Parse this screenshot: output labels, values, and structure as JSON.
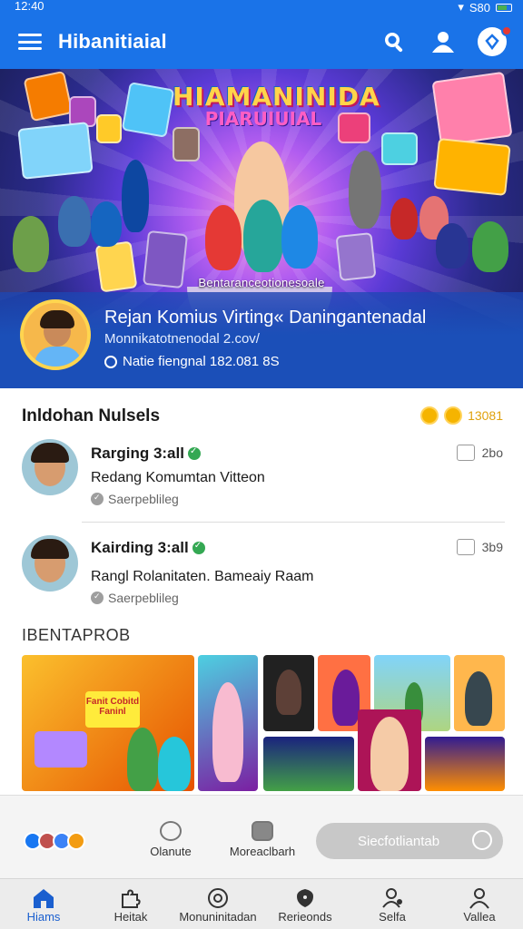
{
  "status_bar": {
    "time": "12:40",
    "signal": "S80"
  },
  "app_bar": {
    "title": "Hibanitiaial",
    "icons": [
      "menu-icon",
      "search-icon",
      "profile-icon",
      "notification-icon"
    ]
  },
  "hero": {
    "banner_line1": "HIAMANINIDA",
    "banner_line2": "PIARUIUIAL",
    "caption": "Bentaranceotionesoale",
    "profile_name": "Rejan Komius Virting« Daningantenadal",
    "profile_handle": "Monnikatotnenodal 2.cov/",
    "profile_meta": "Natie fiengnal  182.081 8S"
  },
  "feed": {
    "section_title": "Inldohan Nulsels",
    "section_count": "13081",
    "posts": [
      {
        "author": "Rarging 3:all",
        "text": "Redang Komumtan Vitteon",
        "sub": "Saerpeblileg",
        "time": "2bo"
      },
      {
        "author": "Kairding 3:all",
        "text": "Rangl Rolanitaten. Bameaiy Raam",
        "sub": "Saerpeblileg",
        "time": "3b9"
      }
    ]
  },
  "gallery": {
    "title": "IBENTAPROB",
    "tile_text": "Fanit Cobitd Faninl"
  },
  "share_row": {
    "action1": "Olanute",
    "action2": "Moreaclbarh",
    "cta": "Siecfotliantab"
  },
  "bottom_nav": {
    "items": [
      {
        "label": "Hiams",
        "icon": "home-icon"
      },
      {
        "label": "Heitak",
        "icon": "puzzle-icon"
      },
      {
        "label": "Monuninitadan",
        "icon": "target-icon"
      },
      {
        "label": "Rerieonds",
        "icon": "shield-icon"
      },
      {
        "label": "Selfa",
        "icon": "user-settings-icon"
      },
      {
        "label": "Vallea",
        "icon": "user-icon"
      }
    ]
  },
  "colors": {
    "primary": "#1a73e8",
    "profile_band": "#1b4fb8",
    "accent_gold": "#f5b400",
    "verified": "#34a853",
    "active_nav": "#1a5fcf"
  }
}
